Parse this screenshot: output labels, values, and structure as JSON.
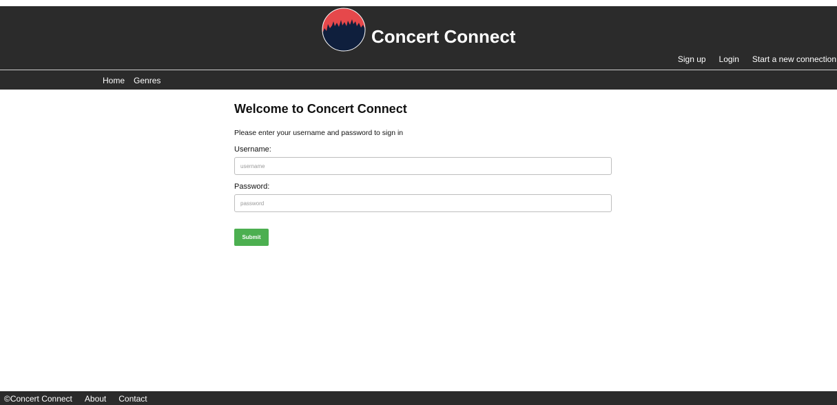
{
  "header": {
    "site_title": "Concert Connect",
    "logo_icon": "crowd-logo-icon",
    "links": [
      "Sign up",
      "Login",
      "Start a new connection"
    ]
  },
  "nav": {
    "items": [
      "Home",
      "Genres"
    ]
  },
  "main": {
    "title": "Welcome to Concert Connect",
    "instructions": "Please enter your username and password to sign in",
    "username_label": "Username:",
    "username_placeholder": "username",
    "password_label": "Password:",
    "password_placeholder": "password",
    "submit_label": "Submit"
  },
  "footer": {
    "copyright": "©Concert Connect",
    "links": [
      "About",
      "Contact"
    ]
  },
  "colors": {
    "bar_background": "#2b2b2b",
    "submit_button": "#4caf50",
    "logo_red": "#e6484b",
    "logo_navy": "#0f1f3d"
  }
}
